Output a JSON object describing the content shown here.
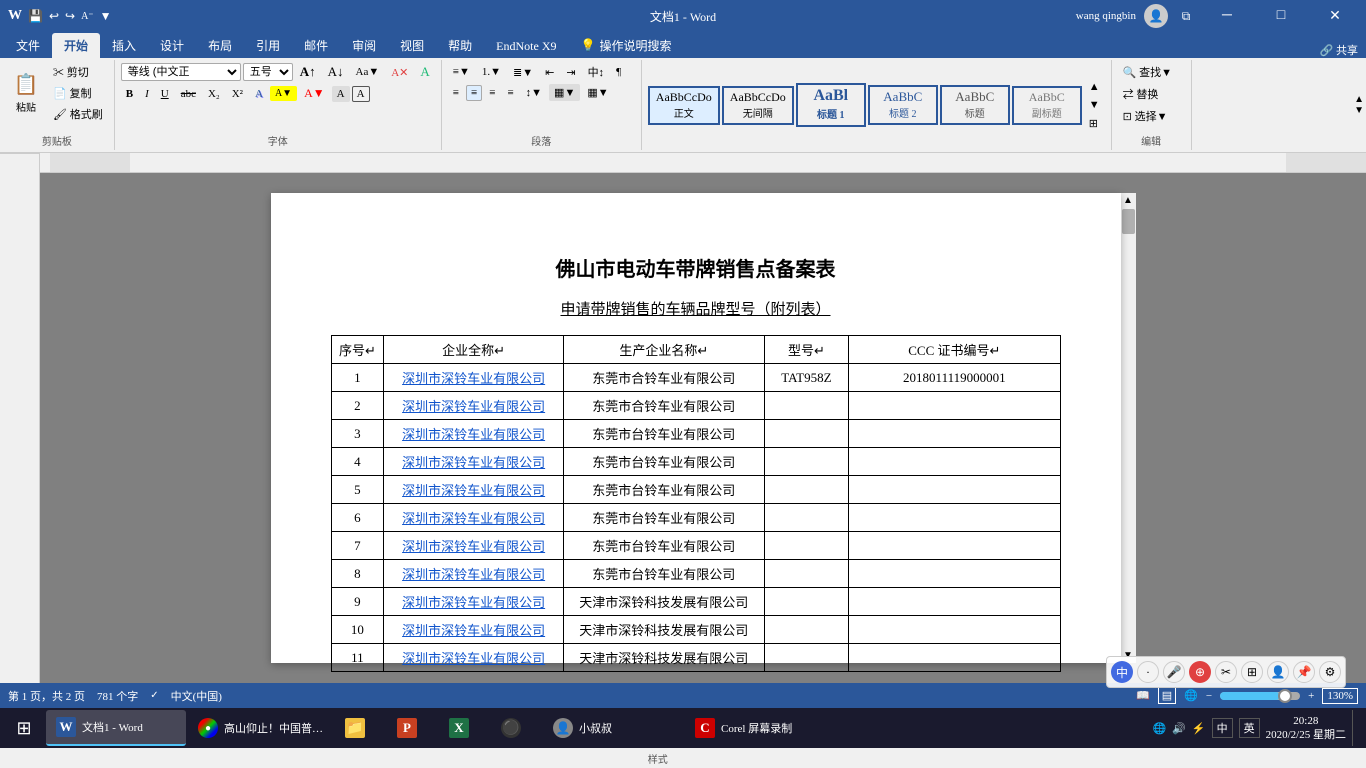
{
  "titlebar": {
    "title": "文档1 - Word",
    "user": "wang qingbin",
    "controls": {
      "minimize": "─",
      "maximize": "□",
      "close": "✕"
    }
  },
  "ribbon": {
    "tabs": [
      "文件",
      "开始",
      "插入",
      "设计",
      "布局",
      "引用",
      "邮件",
      "审阅",
      "视图",
      "帮助",
      "EndNote X9",
      "操作说明搜索"
    ],
    "active_tab": "开始",
    "groups": {
      "clipboard": "剪贴板",
      "font": "字体",
      "paragraph": "段落",
      "styles": "样式",
      "editing": "编辑"
    },
    "font_name": "等线 (中文正",
    "font_size": "五号",
    "styles": [
      "正文",
      "无间隔",
      "标题 1",
      "标题 2",
      "标题",
      "副标题"
    ]
  },
  "document": {
    "title": "佛山市电动车带牌销售点备案表",
    "subtitle": "申请带牌销售的车辆品牌型号（附列表）",
    "table": {
      "headers": [
        "序号",
        "企业全称",
        "生产企业名称",
        "型号",
        "CCC 证书编号"
      ],
      "rows": [
        {
          "num": "1",
          "company": "深圳市深铃车业有限公司",
          "manufacturer": "东莞市合铃车业有限公司",
          "model": "TAT958Z",
          "ccc": "2018011119000001"
        },
        {
          "num": "2",
          "company": "深圳市深铃车业有限公司",
          "manufacturer": "东莞市合铃车业有限公司",
          "model": "",
          "ccc": ""
        },
        {
          "num": "3",
          "company": "深圳市深铃车业有限公司",
          "manufacturer": "东莞市台铃车业有限公司",
          "model": "",
          "ccc": ""
        },
        {
          "num": "4",
          "company": "深圳市深铃车业有限公司",
          "manufacturer": "东莞市台铃车业有限公司",
          "model": "",
          "ccc": ""
        },
        {
          "num": "5",
          "company": "深圳市深铃车业有限公司",
          "manufacturer": "东莞市台铃车业有限公司",
          "model": "",
          "ccc": ""
        },
        {
          "num": "6",
          "company": "深圳市深铃车业有限公司",
          "manufacturer": "东莞市台铃车业有限公司",
          "model": "",
          "ccc": ""
        },
        {
          "num": "7",
          "company": "深圳市深铃车业有限公司",
          "manufacturer": "东莞市台铃车业有限公司",
          "model": "",
          "ccc": ""
        },
        {
          "num": "8",
          "company": "深圳市深铃车业有限公司",
          "manufacturer": "东莞市台铃车业有限公司",
          "model": "",
          "ccc": ""
        },
        {
          "num": "9",
          "company": "深圳市深铃车业有限公司",
          "manufacturer": "天津市深铃科技发展有限公司",
          "model": "",
          "ccc": ""
        },
        {
          "num": "10",
          "company": "深圳市深铃车业有限公司",
          "manufacturer": "天津市深铃科技发展有限公司",
          "model": "",
          "ccc": ""
        },
        {
          "num": "11",
          "company": "深圳市深铃车业有限公司",
          "manufacturer": "天津市深铃科技发展有限公司",
          "model": "",
          "ccc": ""
        }
      ]
    }
  },
  "statusbar": {
    "page_info": "第 1 页，共 2 页",
    "word_count": "781 个字",
    "language": "中文(中国)",
    "zoom": "130%",
    "view_modes": [
      "阅读",
      "页面",
      "Web"
    ]
  },
  "taskbar": {
    "items": [
      {
        "label": "文档1 - Word",
        "icon": "W",
        "icon_color": "#2b579a",
        "active": true
      },
      {
        "label": "高山仰止！中国普…",
        "icon": "G",
        "icon_color": "#e8a000",
        "active": false
      },
      {
        "label": "",
        "icon": "📁",
        "icon_color": "#f0c040",
        "active": false
      },
      {
        "label": "",
        "icon": "X",
        "icon_color": "#1e7145",
        "active": false
      },
      {
        "label": "",
        "icon": "⚫",
        "icon_color": "#333",
        "active": false
      },
      {
        "label": "小叔叔",
        "icon": "人",
        "icon_color": "#888",
        "active": false
      },
      {
        "label": "Corel 屏幕录制",
        "icon": "C",
        "icon_color": "#c00",
        "active": false
      }
    ],
    "time": "20:28",
    "date": "2020/2/25 星期二",
    "sys_icons": [
      "中",
      "英"
    ]
  }
}
